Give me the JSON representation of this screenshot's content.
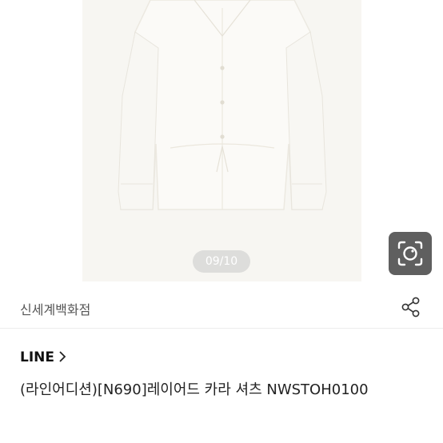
{
  "gallery": {
    "counter": "09/10",
    "image_alt": "white collared shirt product photo"
  },
  "icons": {
    "lens": "camera-lens-search-icon",
    "share": "share-icon",
    "chevron": "chevron-right-icon"
  },
  "store": {
    "name": "신세계백화점"
  },
  "product": {
    "brand": "LINE",
    "title": "(라인어디션)[N690]레이어드 카라 셔츠 NWSTOH0100"
  },
  "colors": {
    "photo_bg": "#f7f6f2",
    "counter_bg": "#c8c8c8",
    "lens_bg": "#5f5f5f"
  }
}
